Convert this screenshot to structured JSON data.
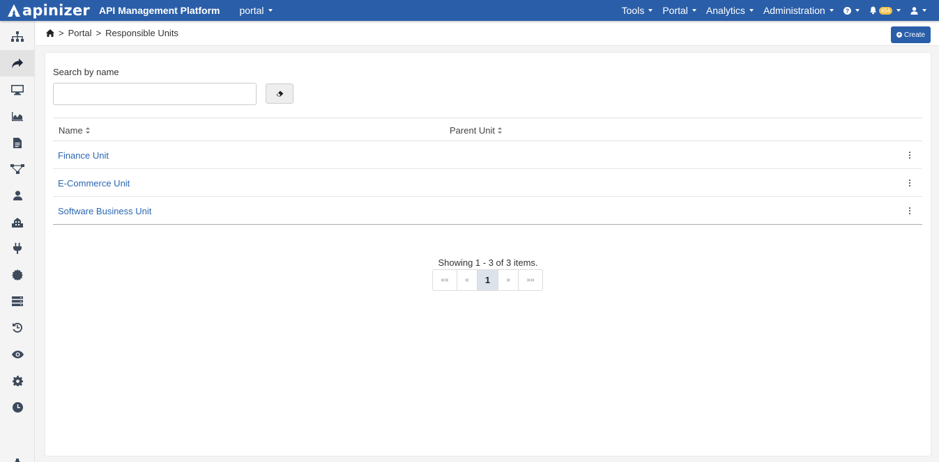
{
  "brand": {
    "logo_text": "apinizer",
    "title": "API Management Platform",
    "project": "portal"
  },
  "nav": {
    "items": [
      "Tools",
      "Portal",
      "Analytics",
      "Administration"
    ],
    "notification_count": "454"
  },
  "breadcrumb": {
    "items": [
      "Portal",
      "Responsible Units"
    ],
    "separator": ">"
  },
  "header": {
    "create_label": "Create"
  },
  "search": {
    "label": "Search by name",
    "value": "",
    "placeholder": ""
  },
  "table": {
    "columns": [
      "Name",
      "Parent Unit"
    ],
    "rows": [
      {
        "name": "Finance Unit",
        "parent": ""
      },
      {
        "name": "E-Commerce Unit",
        "parent": ""
      },
      {
        "name": "Software Business Unit",
        "parent": ""
      }
    ]
  },
  "pagination": {
    "summary": "Showing 1 - 3 of 3 items.",
    "first": "««",
    "prev": "«",
    "current": "1",
    "next": "»",
    "last": "»»"
  },
  "colors": {
    "primary": "#2a5ea9",
    "link": "#2a66b1",
    "badge": "#f0c24a"
  },
  "sidebar": {
    "icons": [
      "sitemap-icon",
      "share-icon",
      "monitor-icon",
      "area-chart-icon",
      "document-icon",
      "flow-icon",
      "user-icon",
      "building-icon",
      "plug-icon",
      "gear-badge-icon",
      "server-icon",
      "history-icon",
      "eye-icon",
      "settings-icon",
      "clock-icon",
      "pin-icon"
    ]
  }
}
